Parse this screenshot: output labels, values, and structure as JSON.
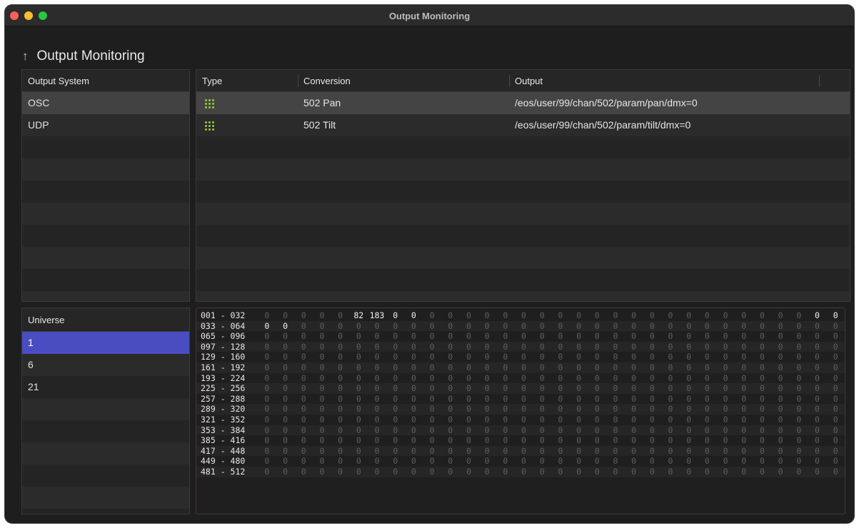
{
  "window": {
    "title": "Output Monitoring"
  },
  "header": {
    "back_icon": "arrow-up-icon",
    "title": "Output Monitoring"
  },
  "output_system": {
    "header": "Output System",
    "items": [
      {
        "label": "OSC",
        "selected": true
      },
      {
        "label": "UDP",
        "selected": false
      }
    ],
    "empty_rows": 8
  },
  "output_table": {
    "columns": [
      "Type",
      "Conversion",
      "Output"
    ],
    "rows": [
      {
        "type_icon": "dot-grid-icon",
        "conversion": "502 Pan",
        "output": "/eos/user/99/chan/502/param/pan/dmx=0",
        "selected": true
      },
      {
        "type_icon": "dot-grid-icon",
        "conversion": "502 Tilt",
        "output": "/eos/user/99/chan/502/param/tilt/dmx=0",
        "selected": false
      }
    ],
    "empty_rows": 8
  },
  "universe": {
    "header": "Universe",
    "items": [
      {
        "label": "1",
        "selected": true
      },
      {
        "label": "6",
        "selected": false
      },
      {
        "label": "21",
        "selected": false
      }
    ],
    "empty_rows": 6
  },
  "dmx": {
    "ranges": [
      "001 - 032",
      "033 - 064",
      "065 - 096",
      "097 - 128",
      "129 - 160",
      "161 - 192",
      "193 - 224",
      "225 - 256",
      "257 - 288",
      "289 - 320",
      "321 - 352",
      "353 - 384",
      "385 - 416",
      "417 - 448",
      "449 - 480",
      "481 - 512"
    ],
    "values": [
      [
        0,
        0,
        0,
        0,
        0,
        82,
        183,
        0,
        0,
        0,
        0,
        0,
        0,
        0,
        0,
        0,
        0,
        0,
        0,
        0,
        0,
        0,
        0,
        0,
        0,
        0,
        0,
        0,
        0,
        0,
        0,
        0
      ],
      [
        0,
        0,
        0,
        0,
        0,
        0,
        0,
        0,
        0,
        0,
        0,
        0,
        0,
        0,
        0,
        0,
        0,
        0,
        0,
        0,
        0,
        0,
        0,
        0,
        0,
        0,
        0,
        0,
        0,
        0,
        0,
        0
      ],
      [
        0,
        0,
        0,
        0,
        0,
        0,
        0,
        0,
        0,
        0,
        0,
        0,
        0,
        0,
        0,
        0,
        0,
        0,
        0,
        0,
        0,
        0,
        0,
        0,
        0,
        0,
        0,
        0,
        0,
        0,
        0,
        0
      ],
      [
        0,
        0,
        0,
        0,
        0,
        0,
        0,
        0,
        0,
        0,
        0,
        0,
        0,
        0,
        0,
        0,
        0,
        0,
        0,
        0,
        0,
        0,
        0,
        0,
        0,
        0,
        0,
        0,
        0,
        0,
        0,
        0
      ],
      [
        0,
        0,
        0,
        0,
        0,
        0,
        0,
        0,
        0,
        0,
        0,
        0,
        0,
        0,
        0,
        0,
        0,
        0,
        0,
        0,
        0,
        0,
        0,
        0,
        0,
        0,
        0,
        0,
        0,
        0,
        0,
        0
      ],
      [
        0,
        0,
        0,
        0,
        0,
        0,
        0,
        0,
        0,
        0,
        0,
        0,
        0,
        0,
        0,
        0,
        0,
        0,
        0,
        0,
        0,
        0,
        0,
        0,
        0,
        0,
        0,
        0,
        0,
        0,
        0,
        0
      ],
      [
        0,
        0,
        0,
        0,
        0,
        0,
        0,
        0,
        0,
        0,
        0,
        0,
        0,
        0,
        0,
        0,
        0,
        0,
        0,
        0,
        0,
        0,
        0,
        0,
        0,
        0,
        0,
        0,
        0,
        0,
        0,
        0
      ],
      [
        0,
        0,
        0,
        0,
        0,
        0,
        0,
        0,
        0,
        0,
        0,
        0,
        0,
        0,
        0,
        0,
        0,
        0,
        0,
        0,
        0,
        0,
        0,
        0,
        0,
        0,
        0,
        0,
        0,
        0,
        0,
        0
      ],
      [
        0,
        0,
        0,
        0,
        0,
        0,
        0,
        0,
        0,
        0,
        0,
        0,
        0,
        0,
        0,
        0,
        0,
        0,
        0,
        0,
        0,
        0,
        0,
        0,
        0,
        0,
        0,
        0,
        0,
        0,
        0,
        0
      ],
      [
        0,
        0,
        0,
        0,
        0,
        0,
        0,
        0,
        0,
        0,
        0,
        0,
        0,
        0,
        0,
        0,
        0,
        0,
        0,
        0,
        0,
        0,
        0,
        0,
        0,
        0,
        0,
        0,
        0,
        0,
        0,
        0
      ],
      [
        0,
        0,
        0,
        0,
        0,
        0,
        0,
        0,
        0,
        0,
        0,
        0,
        0,
        0,
        0,
        0,
        0,
        0,
        0,
        0,
        0,
        0,
        0,
        0,
        0,
        0,
        0,
        0,
        0,
        0,
        0,
        0
      ],
      [
        0,
        0,
        0,
        0,
        0,
        0,
        0,
        0,
        0,
        0,
        0,
        0,
        0,
        0,
        0,
        0,
        0,
        0,
        0,
        0,
        0,
        0,
        0,
        0,
        0,
        0,
        0,
        0,
        0,
        0,
        0,
        0
      ],
      [
        0,
        0,
        0,
        0,
        0,
        0,
        0,
        0,
        0,
        0,
        0,
        0,
        0,
        0,
        0,
        0,
        0,
        0,
        0,
        0,
        0,
        0,
        0,
        0,
        0,
        0,
        0,
        0,
        0,
        0,
        0,
        0
      ],
      [
        0,
        0,
        0,
        0,
        0,
        0,
        0,
        0,
        0,
        0,
        0,
        0,
        0,
        0,
        0,
        0,
        0,
        0,
        0,
        0,
        0,
        0,
        0,
        0,
        0,
        0,
        0,
        0,
        0,
        0,
        0,
        0
      ],
      [
        0,
        0,
        0,
        0,
        0,
        0,
        0,
        0,
        0,
        0,
        0,
        0,
        0,
        0,
        0,
        0,
        0,
        0,
        0,
        0,
        0,
        0,
        0,
        0,
        0,
        0,
        0,
        0,
        0,
        0,
        0,
        0
      ],
      [
        0,
        0,
        0,
        0,
        0,
        0,
        0,
        0,
        0,
        0,
        0,
        0,
        0,
        0,
        0,
        0,
        0,
        0,
        0,
        0,
        0,
        0,
        0,
        0,
        0,
        0,
        0,
        0,
        0,
        0,
        0,
        0
      ]
    ],
    "active_channels": [
      6,
      7,
      8,
      9,
      31,
      32,
      33,
      34
    ]
  }
}
